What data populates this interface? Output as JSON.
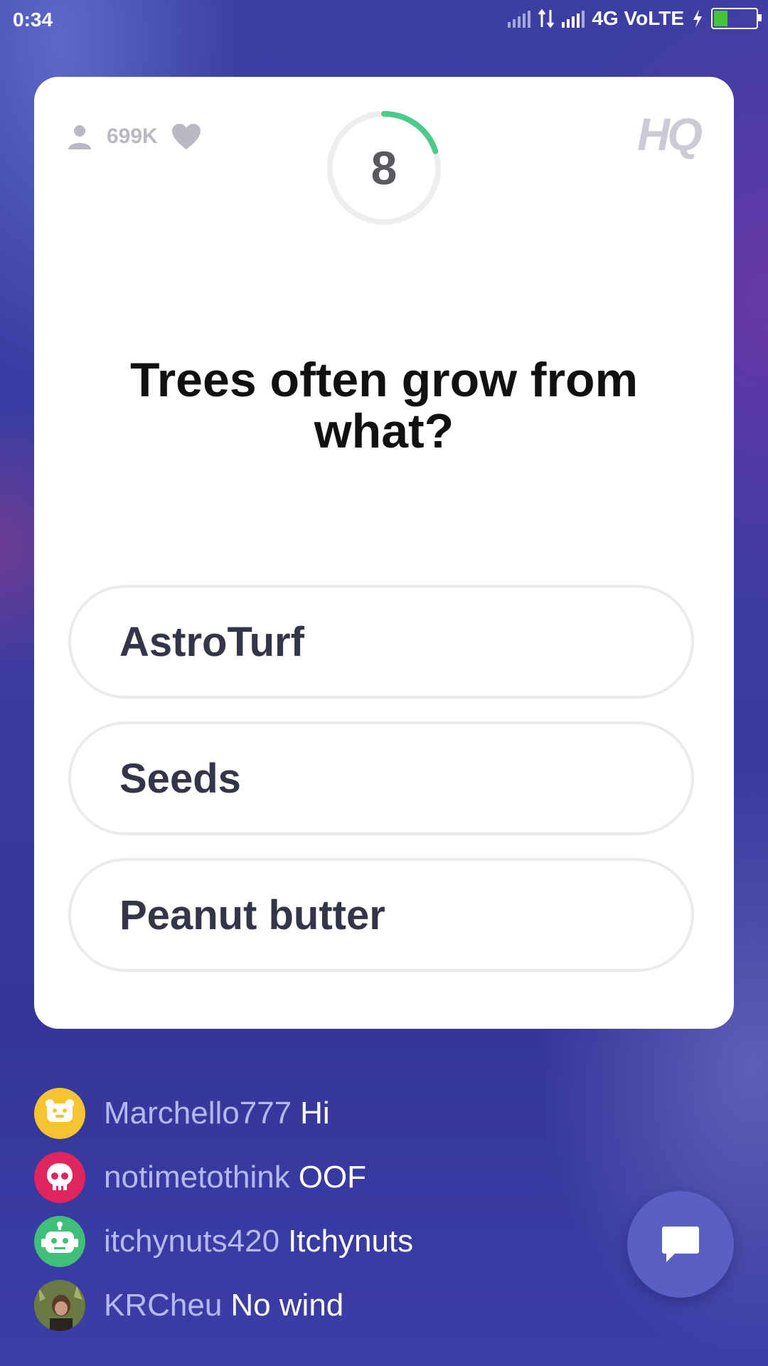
{
  "status_bar": {
    "time": "0:34",
    "network": "4G VoLTE",
    "battery_level": 0.3,
    "battery_color": "#43c43b"
  },
  "header": {
    "viewer_count": "699K",
    "viewer_icon": "person-icon",
    "heart_icon": "heart-icon",
    "timer_value": "8",
    "timer_remaining_fraction": 0.2,
    "timer_color": "#4cca8a",
    "logo_text": "HQ"
  },
  "question": {
    "text": "Trees often grow from what?"
  },
  "answers": [
    {
      "label": "AstroTurf"
    },
    {
      "label": "Seeds"
    },
    {
      "label": "Peanut butter"
    }
  ],
  "chat": {
    "messages": [
      {
        "user": "Marchello777",
        "message": "Hi",
        "avatar_color": "#f5c430",
        "avatar_icon": "bear-face-icon"
      },
      {
        "user": "notimetothink",
        "message": "OOF",
        "avatar_color": "#e0245e",
        "avatar_icon": "skull-icon"
      },
      {
        "user": "itchynuts420",
        "message": "Itchynuts",
        "avatar_color": "#3fbf7a",
        "avatar_icon": "robot-icon"
      },
      {
        "user": "KRCheu",
        "message": "No wind",
        "avatar_color": "#5a6a3a",
        "avatar_icon": "photo-avatar"
      }
    ],
    "open_button_icon": "chat-bubble-icon"
  },
  "colors": {
    "background": "#3a3fa6",
    "card": "#ffffff",
    "username": "#b5b9f3",
    "chat_button": "#5a5fc4"
  }
}
